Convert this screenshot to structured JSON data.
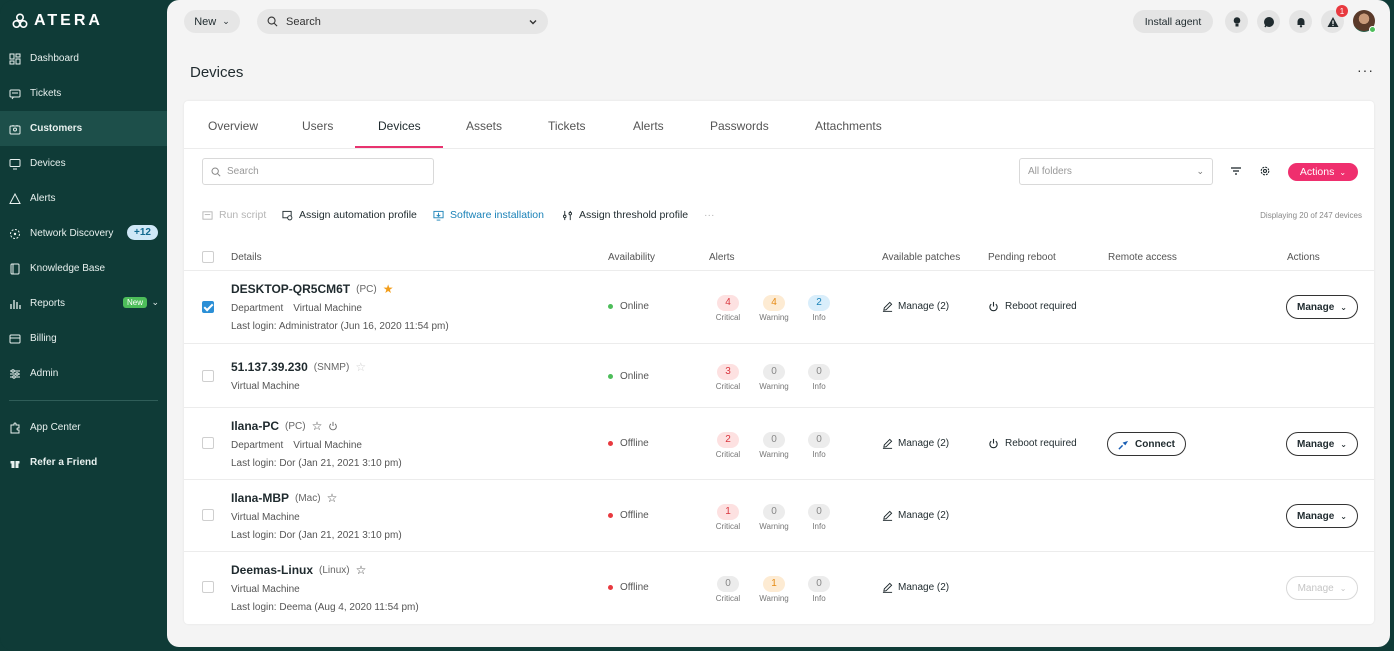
{
  "sidebar": {
    "logo": "ATERA",
    "items": [
      {
        "label": "Dashboard"
      },
      {
        "label": "Tickets"
      },
      {
        "label": "Customers"
      },
      {
        "label": "Devices"
      },
      {
        "label": "Alerts"
      },
      {
        "label": "Network Discovery",
        "badge": "+12"
      },
      {
        "label": "Knowledge Base"
      },
      {
        "label": "Reports",
        "badge": "New"
      },
      {
        "label": "Billing"
      },
      {
        "label": "Admin"
      }
    ],
    "bottom_items": [
      {
        "label": "App Center"
      },
      {
        "label": "Refer a Friend"
      }
    ]
  },
  "topbar": {
    "new_label": "New",
    "search_label": "Search",
    "install_agent_label": "Install agent",
    "alert_count": "1"
  },
  "page": {
    "title": "Devices",
    "more": "···"
  },
  "tabs": [
    "Overview",
    "Users",
    "Devices",
    "Assets",
    "Tickets",
    "Alerts",
    "Passwords",
    "Attachments"
  ],
  "filters": {
    "search_placeholder": "Search",
    "folders_label": "All folders",
    "actions_label": "Actions"
  },
  "toolbar": {
    "run_script": "Run script",
    "assign_automation": "Assign automation profile",
    "software_installation": "Software installation",
    "assign_threshold": "Assign threshold profile",
    "more": "···",
    "displaying": "Displaying 20 of 247 devices"
  },
  "columns": {
    "details": "Details",
    "availability": "Availability",
    "alerts": "Alerts",
    "patches": "Available patches",
    "reboot": "Pending reboot",
    "remote": "Remote access",
    "actions": "Actions"
  },
  "alert_labels": {
    "critical": "Critical",
    "warning": "Warning",
    "info": "Info"
  },
  "colors": {
    "accent": "#ef2f6e",
    "online": "#4dbd5a",
    "offline": "#e8393f",
    "link": "#1a82b8"
  },
  "devices": [
    {
      "name": "DESKTOP-QR5CM6T",
      "type": "(PC)",
      "star": "★",
      "tag1": "Department",
      "tag2": "Virtual Machine",
      "login": "Last login: Administrator (Jun 16, 2020 11:54 pm)",
      "availability": "Online",
      "critical": "4",
      "warning": "4",
      "info": "2",
      "patches": "Manage (2)",
      "reboot": "Reboot required",
      "connect": "",
      "manage": "Manage"
    },
    {
      "name": "51.137.39.230",
      "type": "(SNMP)",
      "star": "☆",
      "tag1": "Virtual Machine",
      "tag2": "",
      "login": "",
      "availability": "Online",
      "critical": "3",
      "warning": "0",
      "info": "0",
      "patches": "",
      "reboot": "",
      "connect": "",
      "manage": ""
    },
    {
      "name": "Ilana-PC",
      "type": "(PC)",
      "star": "☆",
      "tag1": "Department",
      "tag2": "Virtual Machine",
      "login": "Last login: Dor (Jan 21, 2021 3:10 pm)",
      "availability": "Offline",
      "critical": "2",
      "warning": "0",
      "info": "0",
      "patches": "Manage (2)",
      "reboot": "Reboot required",
      "connect": "Connect",
      "manage": "Manage"
    },
    {
      "name": "Ilana-MBP",
      "type": "(Mac)",
      "star": "☆",
      "tag1": "Virtual Machine",
      "tag2": "",
      "login": "Last login: Dor (Jan 21, 2021 3:10 pm)",
      "availability": "Offline",
      "critical": "1",
      "warning": "0",
      "info": "0",
      "patches": "Manage (2)",
      "reboot": "",
      "connect": "",
      "manage": "Manage"
    },
    {
      "name": "Deemas-Linux",
      "type": "(Linux)",
      "star": "☆",
      "tag1": "Virtual Machine",
      "tag2": "",
      "login": "Last login: Deema (Aug 4, 2020 11:54 pm)",
      "availability": "Offline",
      "critical": "0",
      "warning": "1",
      "info": "0",
      "patches": "Manage (2)",
      "reboot": "",
      "connect": "",
      "manage": "Manage"
    }
  ]
}
